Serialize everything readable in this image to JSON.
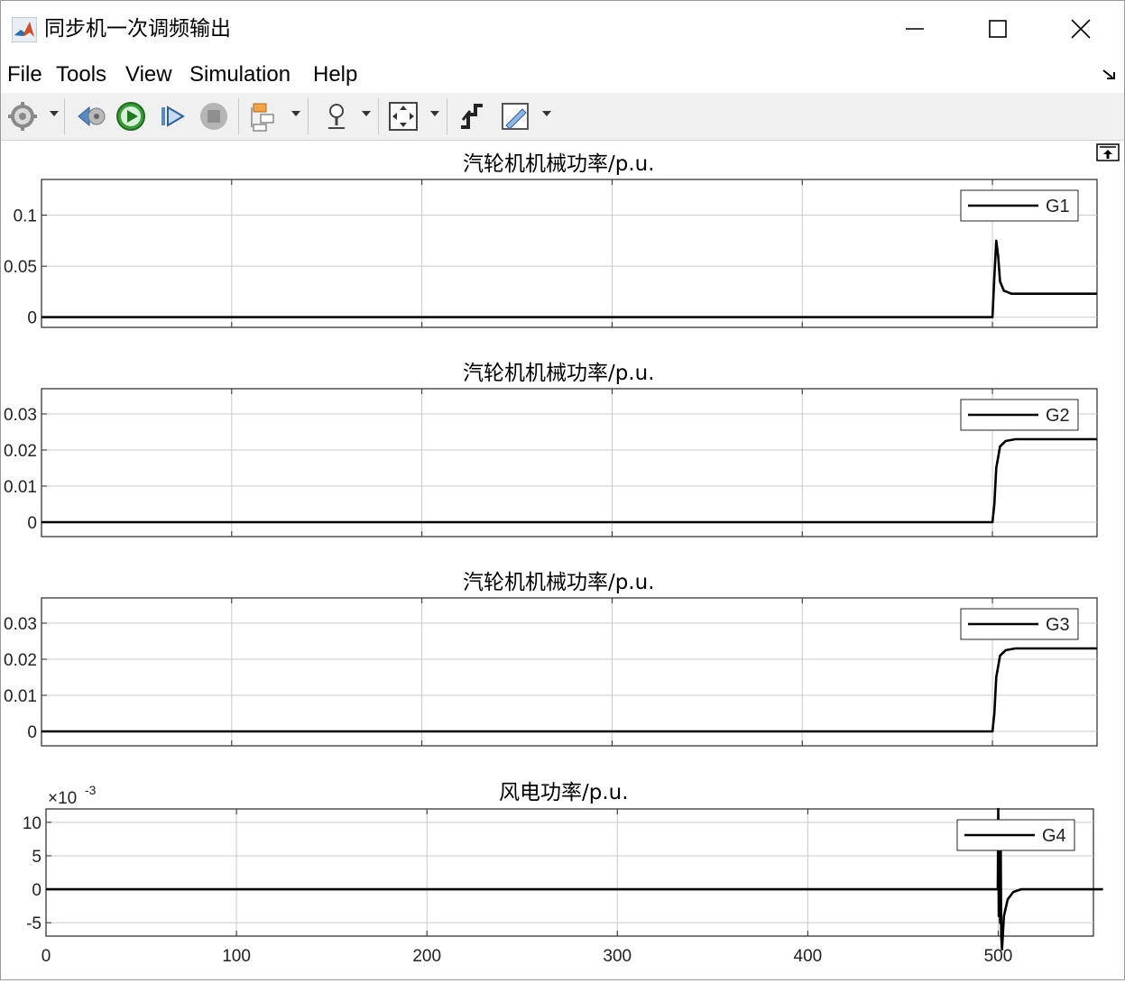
{
  "window": {
    "title": "同步机一次调频输出"
  },
  "menu": {
    "items": [
      "File",
      "Tools",
      "View",
      "Simulation",
      "Help"
    ]
  },
  "toolbar": {
    "icons": [
      "gear-icon",
      "step-back-icon",
      "run-icon",
      "step-forward-icon",
      "stop-icon",
      "signal-config-icon",
      "zoom-icon",
      "fit-to-view-icon",
      "trigger-icon",
      "measure-icon"
    ]
  },
  "plots": [
    {
      "title": "汽轮机机械功率/p.u.",
      "legend": "G1",
      "yticks": [
        "0.1",
        "0.05",
        "0"
      ],
      "exponent": ""
    },
    {
      "title": "汽轮机机械功率/p.u.",
      "legend": "G2",
      "yticks": [
        "0.03",
        "0.02",
        "0.01",
        "0"
      ],
      "exponent": ""
    },
    {
      "title": "汽轮机机械功率/p.u.",
      "legend": "G3",
      "yticks": [
        "0.03",
        "0.02",
        "0.01",
        "0"
      ],
      "exponent": ""
    },
    {
      "title": "风电功率/p.u.",
      "legend": "G4",
      "yticks": [
        "10",
        "5",
        "0",
        "-5"
      ],
      "exponent_base": "×10",
      "exponent_power": "-3"
    }
  ],
  "xaxis": {
    "ticks": [
      "0",
      "100",
      "200",
      "300",
      "400",
      "500"
    ]
  },
  "chart_data": [
    {
      "type": "line",
      "title": "汽轮机机械功率/p.u.",
      "series": [
        {
          "name": "G1",
          "x": [
            0,
            500,
            501,
            502,
            503,
            504,
            506,
            510,
            555
          ],
          "y": [
            0,
            0,
            0.04,
            0.075,
            0.06,
            0.035,
            0.026,
            0.023,
            0.023
          ]
        }
      ],
      "xlim": [
        0,
        555
      ],
      "ylim": [
        -0.01,
        0.135
      ]
    },
    {
      "type": "line",
      "title": "汽轮机机械功率/p.u.",
      "series": [
        {
          "name": "G2",
          "x": [
            0,
            500,
            501,
            502,
            504,
            507,
            512,
            555
          ],
          "y": [
            0,
            0,
            0.005,
            0.015,
            0.021,
            0.0225,
            0.023,
            0.023
          ]
        }
      ],
      "xlim": [
        0,
        555
      ],
      "ylim": [
        -0.004,
        0.037
      ]
    },
    {
      "type": "line",
      "title": "汽轮机机械功率/p.u.",
      "series": [
        {
          "name": "G3",
          "x": [
            0,
            500,
            501,
            502,
            504,
            507,
            512,
            555
          ],
          "y": [
            0,
            0,
            0.005,
            0.015,
            0.021,
            0.0225,
            0.023,
            0.023
          ]
        }
      ],
      "xlim": [
        0,
        555
      ],
      "ylim": [
        -0.004,
        0.037
      ]
    },
    {
      "type": "line",
      "title": "风电功率/p.u.",
      "series": [
        {
          "name": "G4",
          "x": [
            0,
            499.8,
            500,
            500.3,
            500.6,
            501,
            501.3,
            501.6,
            502,
            503,
            505,
            508,
            512,
            555
          ],
          "y": [
            0,
            0,
            12,
            -4,
            10,
            -5,
            8,
            -7,
            -9,
            -4,
            -1.5,
            -0.4,
            0,
            0
          ]
        }
      ],
      "xlim": [
        0,
        550
      ],
      "ylim": [
        -7,
        12
      ],
      "ylabel_multiplier": "×10^-3"
    }
  ]
}
